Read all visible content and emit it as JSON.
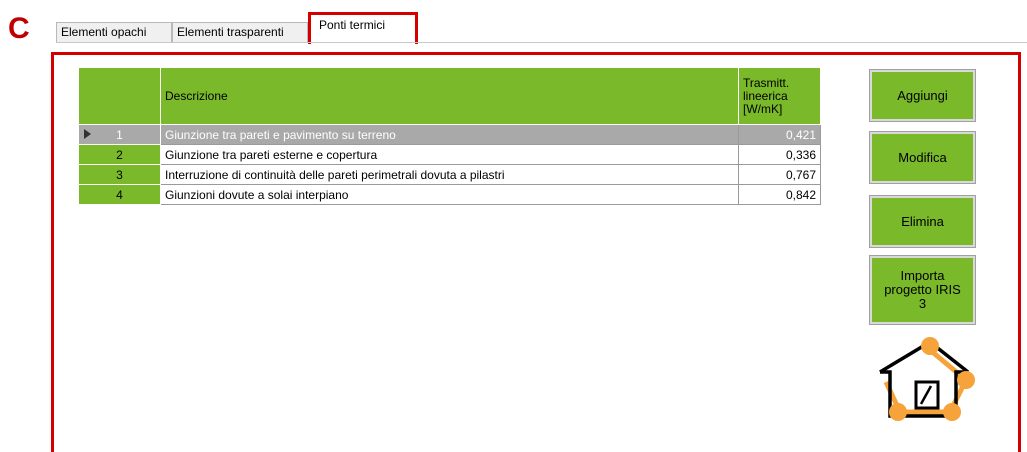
{
  "panel_letter": "C",
  "tabs": [
    {
      "label": "Elementi opachi",
      "active": false
    },
    {
      "label": "Elementi trasparenti",
      "active": false
    },
    {
      "label": "Ponti termici",
      "active": true
    }
  ],
  "grid": {
    "columns": [
      "",
      "Descrizione",
      "Trasmitt. lineerica [W/mK]"
    ],
    "rows": [
      {
        "n": "1",
        "descrizione": "Giunzione tra pareti e pavimento su terreno",
        "valore": "0,421",
        "selected": true
      },
      {
        "n": "2",
        "descrizione": "Giunzione tra pareti esterne e copertura",
        "valore": "0,336",
        "selected": false
      },
      {
        "n": "3",
        "descrizione": "Interruzione di continuità delle pareti perimetrali dovuta a pilastri",
        "valore": "0,767",
        "selected": false
      },
      {
        "n": "4",
        "descrizione": "Giunzioni dovute a solai interpiano",
        "valore": "0,842",
        "selected": false
      }
    ]
  },
  "buttons": {
    "add": "Aggiungi",
    "edit": "Modifica",
    "delete": "Elimina",
    "import": "Importa progetto IRIS 3"
  },
  "colors": {
    "accent_green": "#7ab929",
    "highlight_red": "#d40000",
    "selected_row": "#a9a9a9",
    "logo_orange": "#f5a33a"
  },
  "icons": {
    "row_selector": "triangle-right-icon",
    "logo": "house-network-logo"
  }
}
